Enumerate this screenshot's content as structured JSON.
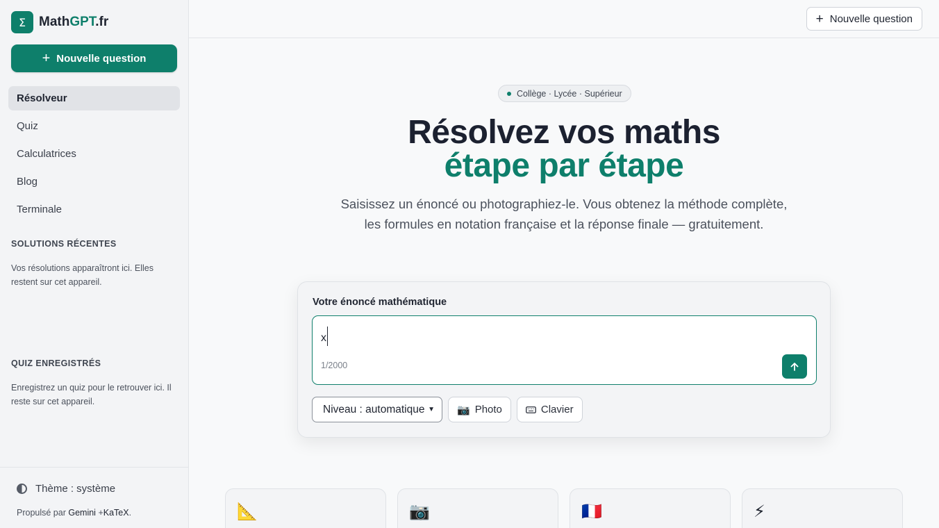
{
  "brand": {
    "logo_symbol": "Σ",
    "name_main": "Math",
    "name_accent": "GPT",
    "name_tld": ".fr",
    "accent_color": "#0e7f6b"
  },
  "sidebar": {
    "new_question": "Nouvelle question",
    "nav": [
      {
        "label": "Résolveur",
        "active": true
      },
      {
        "label": "Quiz"
      },
      {
        "label": "Calculatrices"
      },
      {
        "label": "Blog"
      },
      {
        "label": "Terminale"
      }
    ],
    "recent_title": "SOLUTIONS RÉCENTES",
    "recent_text": "Vos résolutions apparaîtront ici. Elles restent sur cet appareil.",
    "quiz_title": "QUIZ ENREGISTRÉS",
    "quiz_text": "Enregistrez un quiz pour le retrouver ici. Il reste sur cet appareil.",
    "theme_label": "Thème : système",
    "powered_prefix": "Propulsé par",
    "powered_gemini": "Gemini",
    "powered_plus": "+",
    "powered_katex": "KaTeX",
    "powered_suffix": "."
  },
  "header": {
    "new_question": "Nouvelle question"
  },
  "hero": {
    "badge": "Collège · Lycée · Supérieur",
    "title_line1": "Résolvez vos maths",
    "title_line2": "étape par étape",
    "subtitle_line1": "Saisissez un énoncé ou photographiez-le. Vous obtenez la méthode complète,",
    "subtitle_line2": "les formules en notation française et la réponse finale — gratuitement."
  },
  "input_card": {
    "label": "Votre énoncé mathématique",
    "value": "x",
    "counter": "1/2000",
    "level_select": "Niveau : automatique",
    "photo_button": "Photo",
    "keyboard_button": "Clavier",
    "photo_icon": "camera-icon",
    "keyboard_icon": "keyboard-icon"
  },
  "features": [
    {
      "icon": "triangular-ruler-icon",
      "glyph": "📐"
    },
    {
      "icon": "camera-icon",
      "glyph": "📷"
    },
    {
      "icon": "french-flag-icon",
      "glyph": "🇫🇷"
    },
    {
      "icon": "lightning-icon",
      "glyph": "⚡"
    }
  ]
}
